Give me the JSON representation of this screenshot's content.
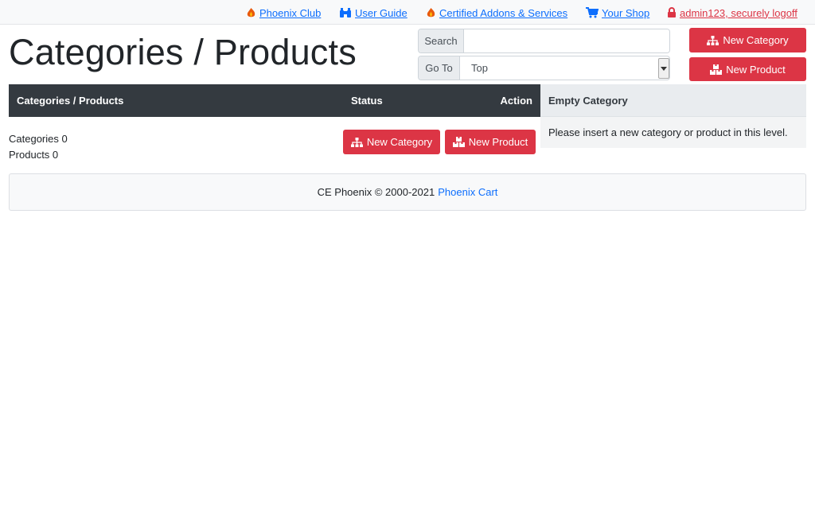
{
  "topnav": {
    "items": [
      {
        "label": "Phoenix Club",
        "icon": "phoenix-icon"
      },
      {
        "label": "User Guide",
        "icon": "binoculars-icon"
      },
      {
        "label": "Certified Addons & Services",
        "icon": "phoenix-icon"
      },
      {
        "label": "Your Shop",
        "icon": "cart-icon"
      },
      {
        "label": "admin123, securely logoff",
        "icon": "lock-icon"
      }
    ]
  },
  "page": {
    "title": "Categories / Products"
  },
  "search": {
    "label": "Search",
    "value": ""
  },
  "goto": {
    "label": "Go To",
    "selected": "Top"
  },
  "buttons": {
    "new_category": "New Category",
    "new_product": "New Product"
  },
  "table": {
    "headers": {
      "name": "Categories / Products",
      "status": "Status",
      "action": "Action"
    }
  },
  "counts": {
    "categories": "Categories 0",
    "products": "Products 0"
  },
  "side": {
    "title": "Empty Category",
    "message": "Please insert a new category or product in this level."
  },
  "footer": {
    "text": "CE Phoenix © 2000-2021",
    "link": "Phoenix Cart"
  },
  "colors": {
    "accent": "#dc3545",
    "link": "#0d6efd",
    "header_dark": "#343a40"
  }
}
